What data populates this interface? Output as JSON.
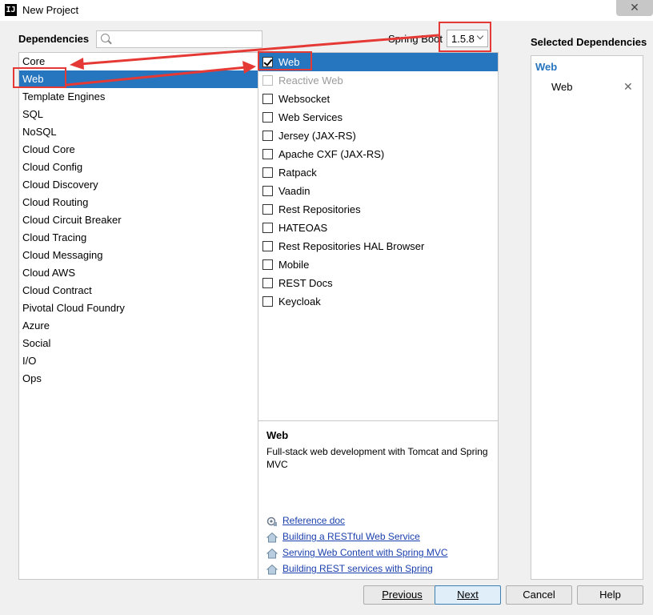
{
  "window": {
    "title": "New Project",
    "app_icon": "IJ"
  },
  "header": {
    "dependencies_label": "Dependencies",
    "search_value": "",
    "spring_boot_label": "Spring Boot",
    "spring_boot_version": "1.5.8",
    "selected_label": "Selected Dependencies"
  },
  "categories": [
    "Core",
    "Web",
    "Template Engines",
    "SQL",
    "NoSQL",
    "Cloud Core",
    "Cloud Config",
    "Cloud Discovery",
    "Cloud Routing",
    "Cloud Circuit Breaker",
    "Cloud Tracing",
    "Cloud Messaging",
    "Cloud AWS",
    "Cloud Contract",
    "Pivotal Cloud Foundry",
    "Azure",
    "Social",
    "I/O",
    "Ops"
  ],
  "selected_category": "Web",
  "dependencies": [
    {
      "label": "Web",
      "checked": true,
      "enabled": true
    },
    {
      "label": "Reactive Web",
      "checked": false,
      "enabled": false
    },
    {
      "label": "Websocket",
      "checked": false,
      "enabled": true
    },
    {
      "label": "Web Services",
      "checked": false,
      "enabled": true
    },
    {
      "label": "Jersey (JAX-RS)",
      "checked": false,
      "enabled": true
    },
    {
      "label": "Apache CXF (JAX-RS)",
      "checked": false,
      "enabled": true
    },
    {
      "label": "Ratpack",
      "checked": false,
      "enabled": true
    },
    {
      "label": "Vaadin",
      "checked": false,
      "enabled": true
    },
    {
      "label": "Rest Repositories",
      "checked": false,
      "enabled": true
    },
    {
      "label": "HATEOAS",
      "checked": false,
      "enabled": true
    },
    {
      "label": "Rest Repositories HAL Browser",
      "checked": false,
      "enabled": true
    },
    {
      "label": "Mobile",
      "checked": false,
      "enabled": true
    },
    {
      "label": "REST Docs",
      "checked": false,
      "enabled": true
    },
    {
      "label": "Keycloak",
      "checked": false,
      "enabled": true
    }
  ],
  "description": {
    "title": "Web",
    "text": "Full-stack web development with Tomcat and Spring MVC",
    "links": [
      {
        "label": "Reference doc",
        "icon": "reference-doc-icon"
      },
      {
        "label": "Building a RESTful Web Service",
        "icon": "guide-house-icon"
      },
      {
        "label": "Serving Web Content with Spring MVC",
        "icon": "guide-house-icon"
      },
      {
        "label": "Building REST services with Spring",
        "icon": "guide-house-icon"
      }
    ]
  },
  "selected": {
    "group": "Web",
    "items": [
      "Web"
    ],
    "remove_icon": "close-icon"
  },
  "buttons": {
    "previous": {
      "label": "Previous"
    },
    "next": {
      "label": "Next"
    },
    "cancel": {
      "label": "Cancel"
    },
    "help": {
      "label": "Help"
    }
  },
  "colors": {
    "selection": "#2675bf",
    "annotation": "#e53935",
    "link": "#1a3fae"
  }
}
